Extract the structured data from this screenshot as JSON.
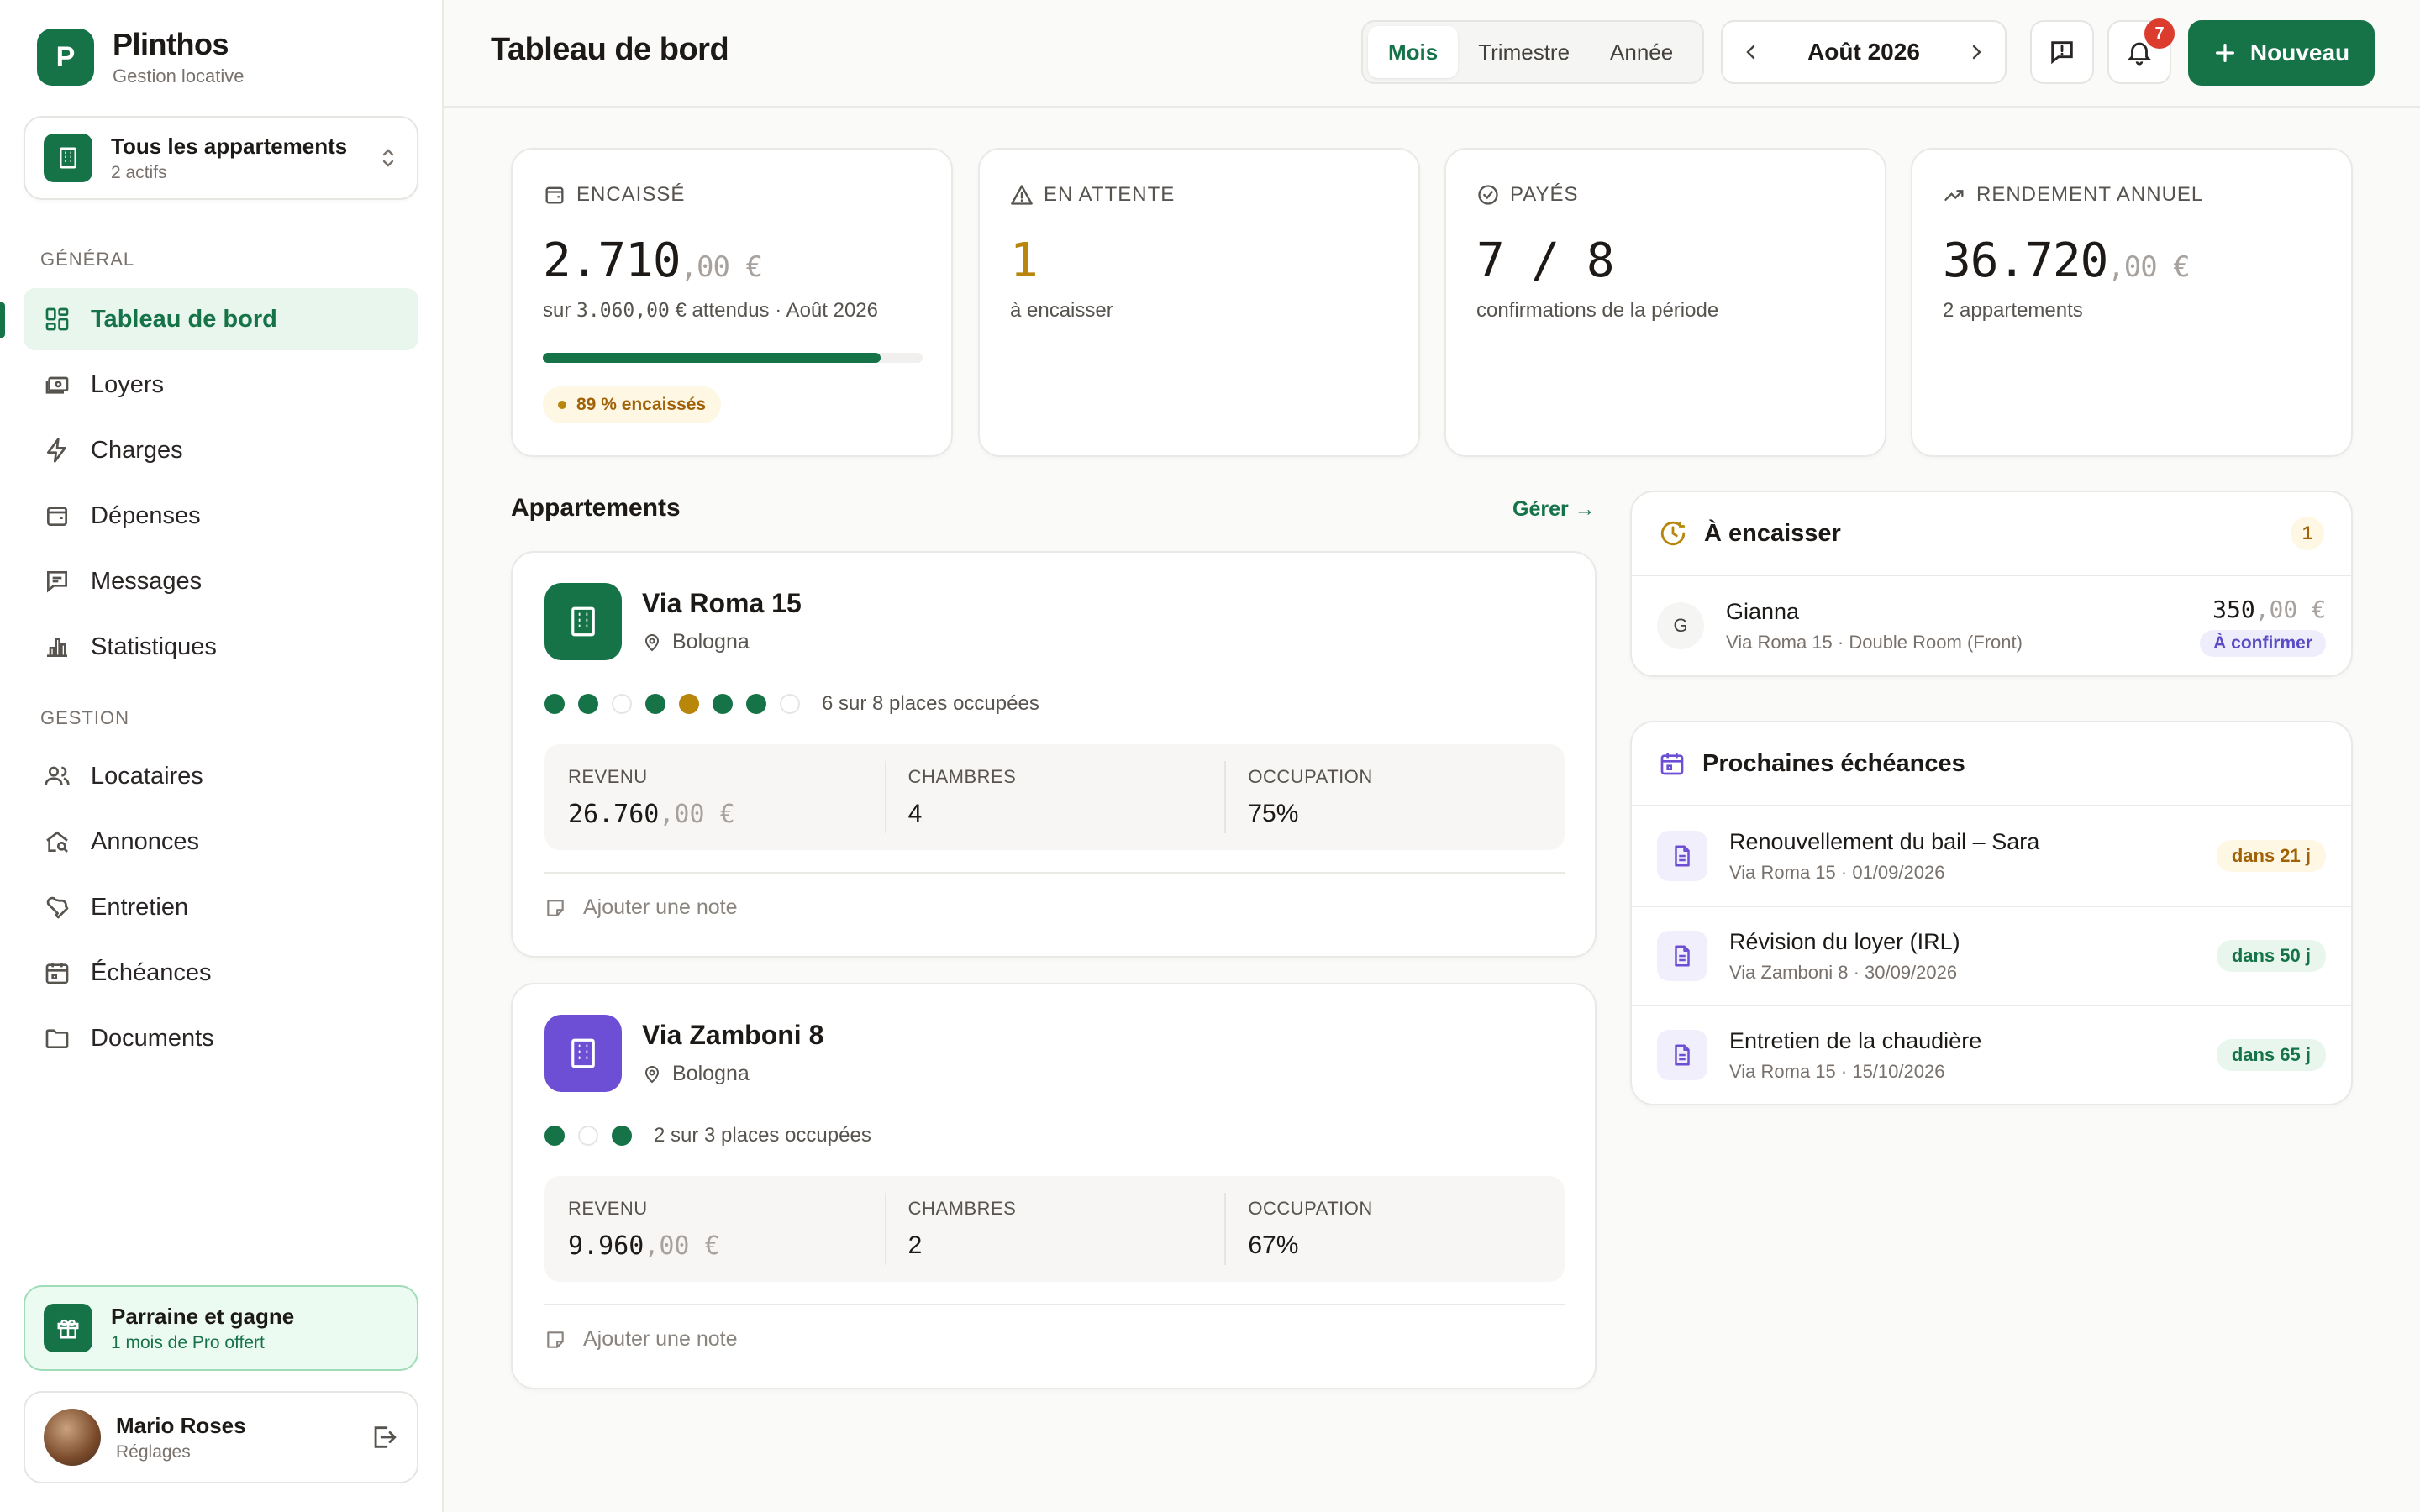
{
  "brand": {
    "initial": "P",
    "name": "Plinthos",
    "subtitle": "Gestion locative"
  },
  "apartment_switch": {
    "label": "Tous les appartements",
    "sublabel": "2 actifs"
  },
  "nav": {
    "general_label": "GÉNÉRAL",
    "general": [
      {
        "label": "Tableau de bord",
        "icon": "dashboard-icon",
        "active": true
      },
      {
        "label": "Loyers",
        "icon": "money-icon"
      },
      {
        "label": "Charges",
        "icon": "bolt-icon"
      },
      {
        "label": "Dépenses",
        "icon": "wallet-icon"
      },
      {
        "label": "Messages",
        "icon": "message-icon"
      },
      {
        "label": "Statistiques",
        "icon": "bar-chart-icon"
      }
    ],
    "gestion_label": "GESTION",
    "gestion": [
      {
        "label": "Locataires",
        "icon": "users-icon"
      },
      {
        "label": "Annonces",
        "icon": "house-search-icon"
      },
      {
        "label": "Entretien",
        "icon": "wrench-icon"
      },
      {
        "label": "Échéances",
        "icon": "calendar-icon"
      },
      {
        "label": "Documents",
        "icon": "folder-icon"
      }
    ]
  },
  "referral": {
    "title": "Parraine et gagne",
    "subtitle": "1 mois de Pro offert"
  },
  "user": {
    "name": "Mario Roses",
    "subtitle": "Réglages"
  },
  "header": {
    "title": "Tableau de bord",
    "periods": [
      "Mois",
      "Trimestre",
      "Année"
    ],
    "active_period": "Mois",
    "current_period": "Août 2026",
    "notifications_count": "7",
    "new_button": "Nouveau"
  },
  "kpis": {
    "encaisse": {
      "label": "ENCAISSÉ",
      "value_int": "2.710",
      "value_dec": ",00 €",
      "sub_prefix": "sur ",
      "sub_amount": "3.060,00",
      "sub_suffix": " € attendus · Août 2026",
      "progress": 0.89,
      "pill": "89 % encaissés"
    },
    "attente": {
      "label": "EN ATTENTE",
      "value": "1",
      "sub": "à encaisser"
    },
    "payes": {
      "label": "PAYÉS",
      "value": "7 / 8",
      "sub": "confirmations de la période"
    },
    "rendement": {
      "label": "RENDEMENT ANNUEL",
      "value_int": "36.720",
      "value_dec": ",00 €",
      "sub": "2 appartements"
    }
  },
  "apartments": {
    "title": "Appartements",
    "manage": "Gérer →",
    "items": [
      {
        "name": "Via Roma 15",
        "city": "Bologna",
        "color": "#157347",
        "places": [
          "g",
          "g",
          "e",
          "g",
          "a",
          "g",
          "g",
          "e"
        ],
        "places_text": "6 sur 8 places occupées",
        "revenue_label": "REVENU",
        "revenue_int": "26.760",
        "revenue_dec": ",00 €",
        "rooms_label": "CHAMBRES",
        "rooms": "4",
        "occupancy_label": "OCCUPATION",
        "occupancy": "75%",
        "note": "Ajouter une note"
      },
      {
        "name": "Via Zamboni 8",
        "city": "Bologna",
        "color": "#6d4fd6",
        "places": [
          "g",
          "e",
          "g"
        ],
        "places_text": "2 sur 3 places occupées",
        "revenue_label": "REVENU",
        "revenue_int": "9.960",
        "revenue_dec": ",00 €",
        "rooms_label": "CHAMBRES",
        "rooms": "2",
        "occupancy_label": "OCCUPATION",
        "occupancy": "67%",
        "note": "Ajouter une note"
      }
    ]
  },
  "to_collect": {
    "title": "À encaisser",
    "count": "1",
    "items": [
      {
        "initial": "G",
        "name": "Gianna",
        "detail": "Via Roma 15 · Double Room (Front)",
        "amount_int": "350",
        "amount_dec": ",00 €",
        "status": "À confirmer"
      }
    ]
  },
  "deadlines": {
    "title": "Prochaines échéances",
    "items": [
      {
        "title": "Renouvellement du bail – Sara",
        "detail": "Via Roma 15 · 01/09/2026",
        "due": "dans 21 j",
        "tone": "amber"
      },
      {
        "title": "Révision du loyer (IRL)",
        "detail": "Via Zamboni 8 · 30/09/2026",
        "due": "dans 50 j",
        "tone": "green"
      },
      {
        "title": "Entretien de la chaudière",
        "detail": "Via Roma 15 · 15/10/2026",
        "due": "dans 65 j",
        "tone": "green"
      }
    ]
  }
}
